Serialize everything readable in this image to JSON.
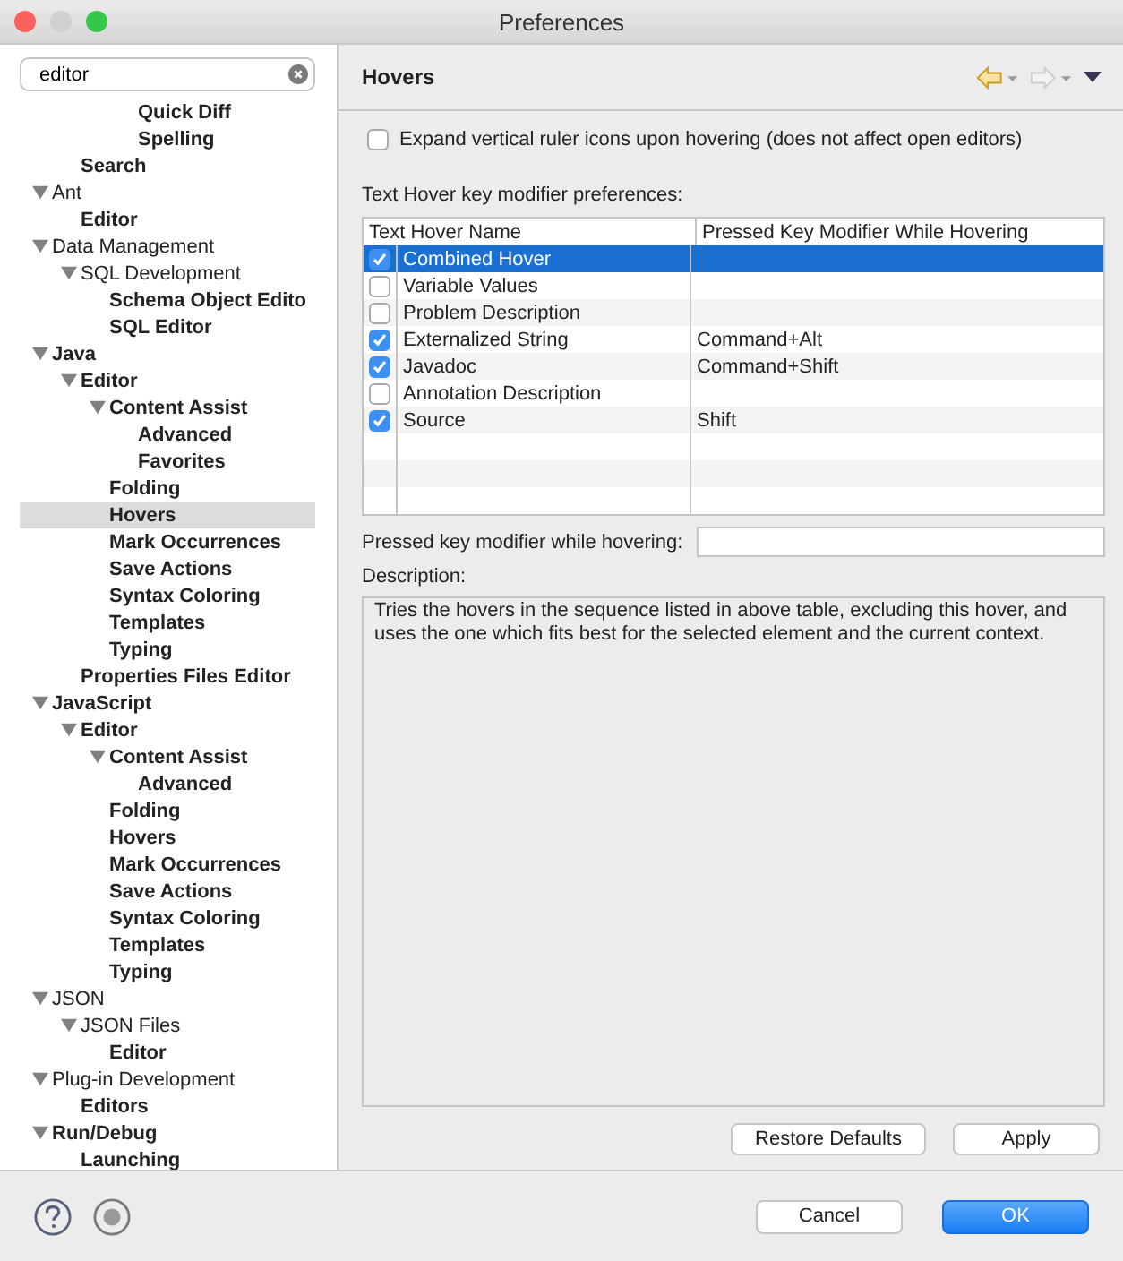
{
  "window": {
    "title": "Preferences"
  },
  "search": {
    "value": "editor"
  },
  "tree": {
    "items": [
      {
        "children": [
          {
            "children": [
              {
                "children": [
                  {
                    "label": "Quick Diff",
                    "bold": true,
                    "selected": false
                  },
                  {
                    "label": "Spelling",
                    "bold": true,
                    "selected": false
                  }
                ]
              }
            ]
          },
          {
            "label": "Search",
            "bold": true,
            "selected": false
          }
        ]
      },
      {
        "label": "Ant",
        "bold": false,
        "selected": false,
        "expanded": true,
        "children": [
          {
            "label": "Editor",
            "bold": true,
            "selected": false
          }
        ]
      },
      {
        "label": "Data Management",
        "bold": false,
        "selected": false,
        "expanded": true,
        "children": [
          {
            "label": "SQL Development",
            "bold": false,
            "selected": false,
            "expanded": true,
            "children": [
              {
                "label": "Schema Object Edito",
                "bold": true,
                "selected": false
              },
              {
                "label": "SQL Editor",
                "bold": true,
                "selected": false
              }
            ]
          }
        ]
      },
      {
        "label": "Java",
        "bold": true,
        "selected": false,
        "expanded": true,
        "children": [
          {
            "label": "Editor",
            "bold": true,
            "selected": false,
            "expanded": true,
            "children": [
              {
                "label": "Content Assist",
                "bold": true,
                "selected": false,
                "expanded": true,
                "children": [
                  {
                    "label": "Advanced",
                    "bold": true,
                    "selected": false
                  },
                  {
                    "label": "Favorites",
                    "bold": true,
                    "selected": false
                  }
                ]
              },
              {
                "label": "Folding",
                "bold": true,
                "selected": false
              },
              {
                "label": "Hovers",
                "bold": true,
                "selected": true
              },
              {
                "label": "Mark Occurrences",
                "bold": true,
                "selected": false
              },
              {
                "label": "Save Actions",
                "bold": true,
                "selected": false
              },
              {
                "label": "Syntax Coloring",
                "bold": true,
                "selected": false
              },
              {
                "label": "Templates",
                "bold": true,
                "selected": false
              },
              {
                "label": "Typing",
                "bold": true,
                "selected": false
              }
            ]
          },
          {
            "label": "Properties Files Editor",
            "bold": true,
            "selected": false
          }
        ]
      },
      {
        "label": "JavaScript",
        "bold": true,
        "selected": false,
        "expanded": true,
        "children": [
          {
            "label": "Editor",
            "bold": true,
            "selected": false,
            "expanded": true,
            "children": [
              {
                "label": "Content Assist",
                "bold": true,
                "selected": false,
                "expanded": true,
                "children": [
                  {
                    "label": "Advanced",
                    "bold": true,
                    "selected": false
                  }
                ]
              },
              {
                "label": "Folding",
                "bold": true,
                "selected": false
              },
              {
                "label": "Hovers",
                "bold": true,
                "selected": false
              },
              {
                "label": "Mark Occurrences",
                "bold": true,
                "selected": false
              },
              {
                "label": "Save Actions",
                "bold": true,
                "selected": false
              },
              {
                "label": "Syntax Coloring",
                "bold": true,
                "selected": false
              },
              {
                "label": "Templates",
                "bold": true,
                "selected": false
              },
              {
                "label": "Typing",
                "bold": true,
                "selected": false
              }
            ]
          }
        ]
      },
      {
        "label": "JSON",
        "bold": false,
        "selected": false,
        "expanded": true,
        "children": [
          {
            "label": "JSON Files",
            "bold": false,
            "selected": false,
            "expanded": true,
            "children": [
              {
                "label": "Editor",
                "bold": true,
                "selected": false
              }
            ]
          }
        ]
      },
      {
        "label": "Plug-in Development",
        "bold": false,
        "selected": false,
        "expanded": true,
        "children": [
          {
            "label": "Editors",
            "bold": true,
            "selected": false
          }
        ]
      },
      {
        "label": "Run/Debug",
        "bold": true,
        "selected": false,
        "expanded": true,
        "children": [
          {
            "label": "Launching",
            "bold": true,
            "selected": false
          }
        ]
      }
    ]
  },
  "page": {
    "title": "Hovers",
    "expand_option": {
      "label": "Expand vertical ruler icons upon hovering (does not affect open editors)",
      "checked": false
    },
    "table_label": "Text Hover key modifier preferences:",
    "table": {
      "columns": [
        "Text Hover Name",
        "Pressed Key Modifier While Hovering"
      ],
      "rows": [
        {
          "name": "Combined Hover",
          "checked": true,
          "selected": true
        },
        {
          "name": "Variable Values",
          "checked": false,
          "selected": false
        },
        {
          "name": "Problem Description",
          "checked": false,
          "selected": false
        },
        {
          "name": "Externalized String",
          "modifier": "Command+Alt",
          "checked": true,
          "selected": false
        },
        {
          "name": "Javadoc",
          "modifier": "Command+Shift",
          "checked": true,
          "selected": false
        },
        {
          "name": "Annotation Description",
          "checked": false,
          "selected": false
        },
        {
          "name": "Source",
          "modifier": "Shift",
          "checked": true,
          "selected": false
        }
      ]
    },
    "modifier_label": "Pressed key modifier while hovering:",
    "description_label": "Description:",
    "description": "Tries the hovers in the sequence listed in above table, excluding this hover, and uses the one which fits best for the selected element and the current context.",
    "buttons": [
      "Restore Defaults",
      "Apply"
    ]
  },
  "footer": {
    "buttons": [
      {
        "label": "Cancel",
        "kind": "secondary"
      },
      {
        "label": "OK",
        "kind": "primary"
      }
    ]
  }
}
